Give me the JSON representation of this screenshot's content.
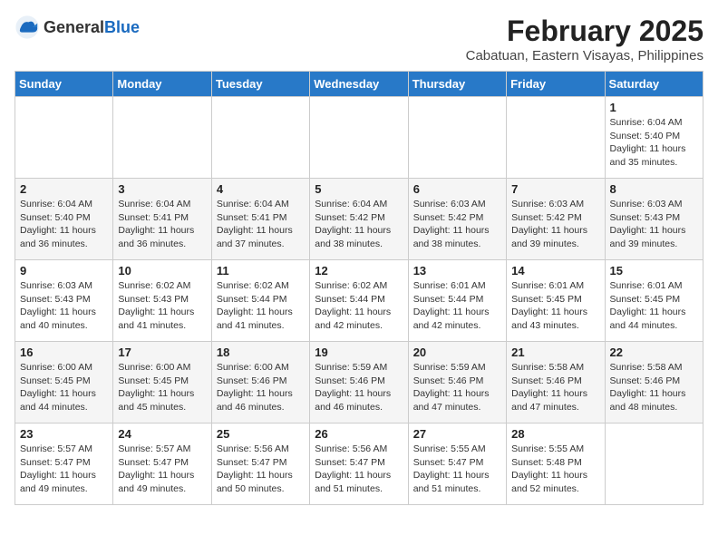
{
  "header": {
    "logo_general": "General",
    "logo_blue": "Blue",
    "month_year": "February 2025",
    "location": "Cabatuan, Eastern Visayas, Philippines"
  },
  "days_of_week": [
    "Sunday",
    "Monday",
    "Tuesday",
    "Wednesday",
    "Thursday",
    "Friday",
    "Saturday"
  ],
  "weeks": [
    [
      {
        "day": "",
        "info": ""
      },
      {
        "day": "",
        "info": ""
      },
      {
        "day": "",
        "info": ""
      },
      {
        "day": "",
        "info": ""
      },
      {
        "day": "",
        "info": ""
      },
      {
        "day": "",
        "info": ""
      },
      {
        "day": "1",
        "info": "Sunrise: 6:04 AM\nSunset: 5:40 PM\nDaylight: 11 hours and 35 minutes."
      }
    ],
    [
      {
        "day": "2",
        "info": "Sunrise: 6:04 AM\nSunset: 5:40 PM\nDaylight: 11 hours and 36 minutes."
      },
      {
        "day": "3",
        "info": "Sunrise: 6:04 AM\nSunset: 5:41 PM\nDaylight: 11 hours and 36 minutes."
      },
      {
        "day": "4",
        "info": "Sunrise: 6:04 AM\nSunset: 5:41 PM\nDaylight: 11 hours and 37 minutes."
      },
      {
        "day": "5",
        "info": "Sunrise: 6:04 AM\nSunset: 5:42 PM\nDaylight: 11 hours and 38 minutes."
      },
      {
        "day": "6",
        "info": "Sunrise: 6:03 AM\nSunset: 5:42 PM\nDaylight: 11 hours and 38 minutes."
      },
      {
        "day": "7",
        "info": "Sunrise: 6:03 AM\nSunset: 5:42 PM\nDaylight: 11 hours and 39 minutes."
      },
      {
        "day": "8",
        "info": "Sunrise: 6:03 AM\nSunset: 5:43 PM\nDaylight: 11 hours and 39 minutes."
      }
    ],
    [
      {
        "day": "9",
        "info": "Sunrise: 6:03 AM\nSunset: 5:43 PM\nDaylight: 11 hours and 40 minutes."
      },
      {
        "day": "10",
        "info": "Sunrise: 6:02 AM\nSunset: 5:43 PM\nDaylight: 11 hours and 41 minutes."
      },
      {
        "day": "11",
        "info": "Sunrise: 6:02 AM\nSunset: 5:44 PM\nDaylight: 11 hours and 41 minutes."
      },
      {
        "day": "12",
        "info": "Sunrise: 6:02 AM\nSunset: 5:44 PM\nDaylight: 11 hours and 42 minutes."
      },
      {
        "day": "13",
        "info": "Sunrise: 6:01 AM\nSunset: 5:44 PM\nDaylight: 11 hours and 42 minutes."
      },
      {
        "day": "14",
        "info": "Sunrise: 6:01 AM\nSunset: 5:45 PM\nDaylight: 11 hours and 43 minutes."
      },
      {
        "day": "15",
        "info": "Sunrise: 6:01 AM\nSunset: 5:45 PM\nDaylight: 11 hours and 44 minutes."
      }
    ],
    [
      {
        "day": "16",
        "info": "Sunrise: 6:00 AM\nSunset: 5:45 PM\nDaylight: 11 hours and 44 minutes."
      },
      {
        "day": "17",
        "info": "Sunrise: 6:00 AM\nSunset: 5:45 PM\nDaylight: 11 hours and 45 minutes."
      },
      {
        "day": "18",
        "info": "Sunrise: 6:00 AM\nSunset: 5:46 PM\nDaylight: 11 hours and 46 minutes."
      },
      {
        "day": "19",
        "info": "Sunrise: 5:59 AM\nSunset: 5:46 PM\nDaylight: 11 hours and 46 minutes."
      },
      {
        "day": "20",
        "info": "Sunrise: 5:59 AM\nSunset: 5:46 PM\nDaylight: 11 hours and 47 minutes."
      },
      {
        "day": "21",
        "info": "Sunrise: 5:58 AM\nSunset: 5:46 PM\nDaylight: 11 hours and 47 minutes."
      },
      {
        "day": "22",
        "info": "Sunrise: 5:58 AM\nSunset: 5:46 PM\nDaylight: 11 hours and 48 minutes."
      }
    ],
    [
      {
        "day": "23",
        "info": "Sunrise: 5:57 AM\nSunset: 5:47 PM\nDaylight: 11 hours and 49 minutes."
      },
      {
        "day": "24",
        "info": "Sunrise: 5:57 AM\nSunset: 5:47 PM\nDaylight: 11 hours and 49 minutes."
      },
      {
        "day": "25",
        "info": "Sunrise: 5:56 AM\nSunset: 5:47 PM\nDaylight: 11 hours and 50 minutes."
      },
      {
        "day": "26",
        "info": "Sunrise: 5:56 AM\nSunset: 5:47 PM\nDaylight: 11 hours and 51 minutes."
      },
      {
        "day": "27",
        "info": "Sunrise: 5:55 AM\nSunset: 5:47 PM\nDaylight: 11 hours and 51 minutes."
      },
      {
        "day": "28",
        "info": "Sunrise: 5:55 AM\nSunset: 5:48 PM\nDaylight: 11 hours and 52 minutes."
      },
      {
        "day": "",
        "info": ""
      }
    ]
  ]
}
